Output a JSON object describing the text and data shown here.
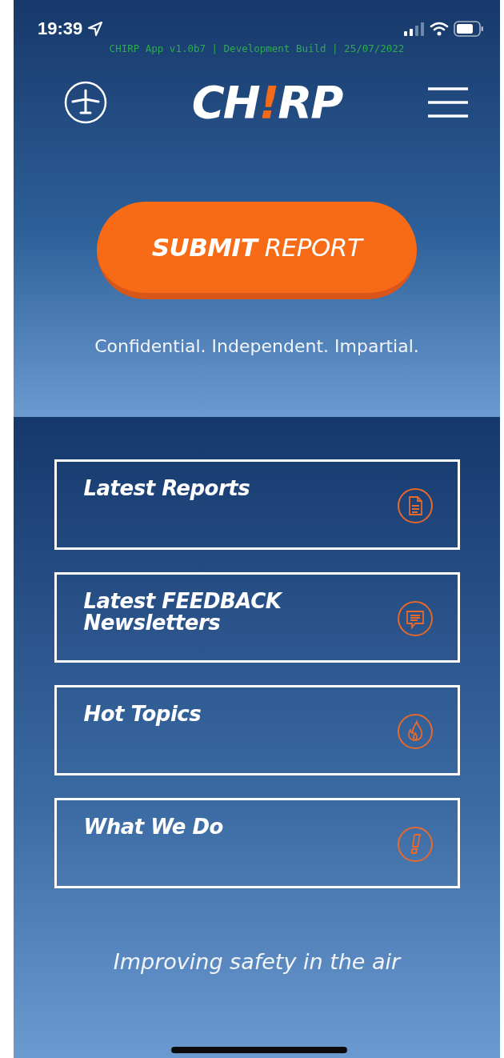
{
  "status_bar": {
    "time": "19:39"
  },
  "build_info": "CHIRP App v1.0b7 | Development Build | 25/07/2022",
  "logo": [
    {
      "text": "CH",
      "accent": false
    },
    {
      "text": "!",
      "accent": true
    },
    {
      "text": "RP",
      "accent": false
    }
  ],
  "submit_button": "**SUBMIT** REPORT",
  "tagline": "Confidential. Independent. Impartial.",
  "menu_cards": [
    {
      "title": "Latest Reports",
      "kind": "document"
    },
    {
      "title": "Latest FEEDBACK Newsletters",
      "kind": "chat"
    },
    {
      "title": "Hot Topics",
      "kind": "flame"
    },
    {
      "title": "What We Do",
      "kind": "exclamation"
    }
  ],
  "footer": "Improving safety in the air"
}
